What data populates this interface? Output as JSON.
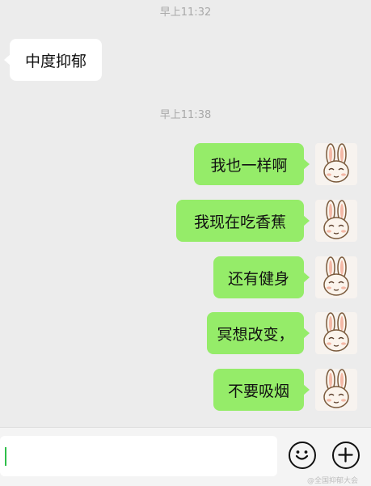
{
  "chat": {
    "timestamps": [
      "早上11:32",
      "早上11:38"
    ],
    "messages": [
      {
        "side": "left",
        "text": "中度抑郁"
      },
      {
        "side": "right",
        "text": "我也一样啊",
        "avatar": "rabbit-sticker-avatar"
      },
      {
        "side": "right",
        "text": "我现在吃香蕉",
        "avatar": "rabbit-sticker-avatar"
      },
      {
        "side": "right",
        "text": "还有健身",
        "avatar": "rabbit-sticker-avatar"
      },
      {
        "side": "right",
        "text": "冥想改变，",
        "avatar": "rabbit-sticker-avatar"
      },
      {
        "side": "right",
        "text": "不要吸烟",
        "avatar": "rabbit-sticker-avatar"
      }
    ]
  },
  "input_bar": {
    "text_value": "",
    "emoji_icon": "smile-icon",
    "add_icon": "plus-icon"
  },
  "watermark": "@全国抑郁大会",
  "colors": {
    "background": "#ececec",
    "outgoing_bubble": "#95ec69",
    "incoming_bubble": "#ffffff",
    "caret": "#2fbf4a"
  }
}
